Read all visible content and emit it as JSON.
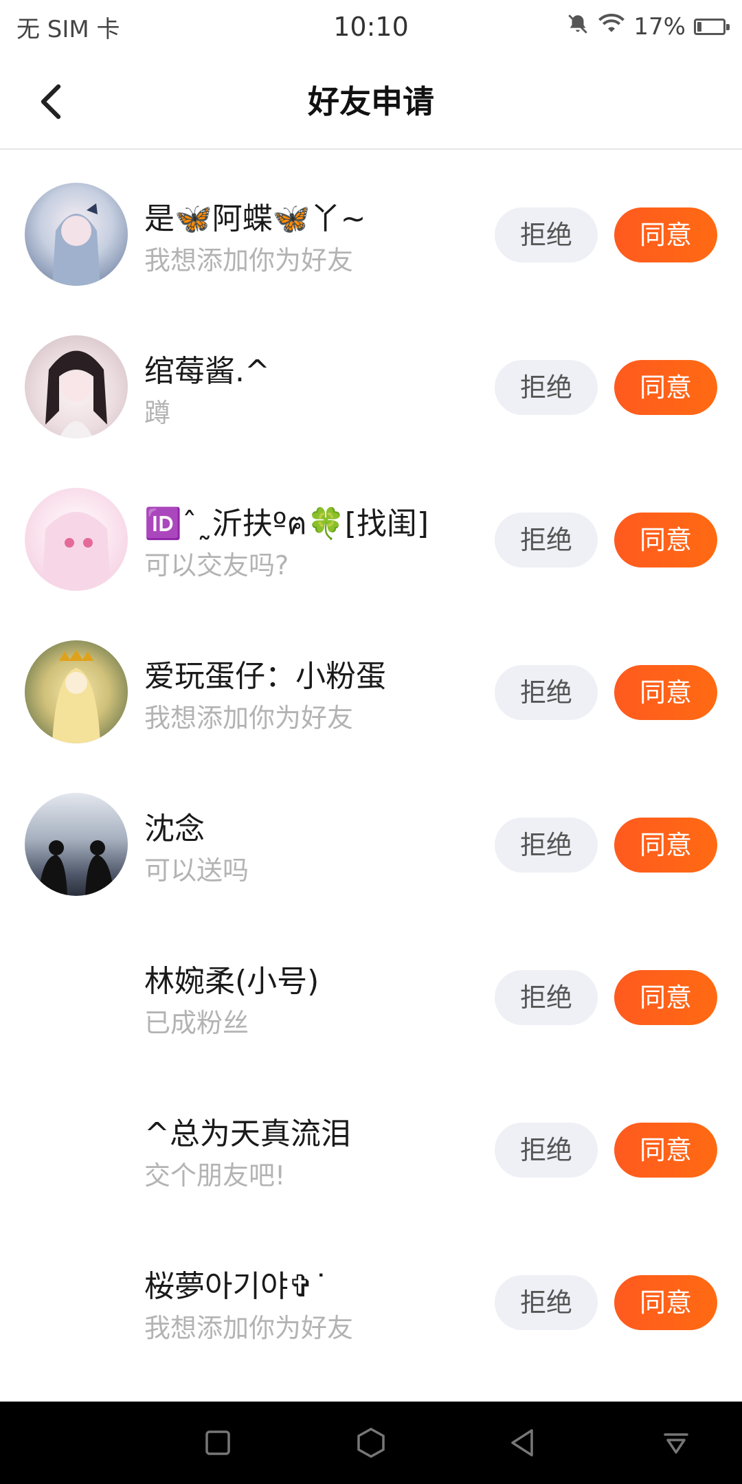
{
  "status_bar": {
    "carrier": "无 SIM 卡",
    "time": "10:10",
    "battery": "17%",
    "battery_level": 0.17
  },
  "header": {
    "title": "好友申请"
  },
  "buttons": {
    "reject_label": "拒绝",
    "accept_label": "同意"
  },
  "requests": [
    {
      "name": "是🦋阿蝶🦋丫~",
      "message": "我想添加你为好友"
    },
    {
      "name": "绾莓酱.^",
      "message": "蹲"
    },
    {
      "name": "🆔ˆ˷沂扶ºฅ🍀[找闺]",
      "message": "可以交友吗?"
    },
    {
      "name": "爱玩蛋仔：小粉蛋",
      "message": "我想添加你为好友"
    },
    {
      "name": "沈念",
      "message": "可以送吗"
    },
    {
      "name": "林婉柔(小号)",
      "message": "已成粉丝"
    },
    {
      "name": "^总为天真流泪",
      "message": "交个朋友吧!"
    },
    {
      "name": "桜夢아기야✞˙",
      "message": "我想添加你为好友"
    }
  ],
  "colors": {
    "accent": "#ff5a1f",
    "reject_bg": "#eef0f5",
    "secondary_text": "#b3b3b3"
  }
}
